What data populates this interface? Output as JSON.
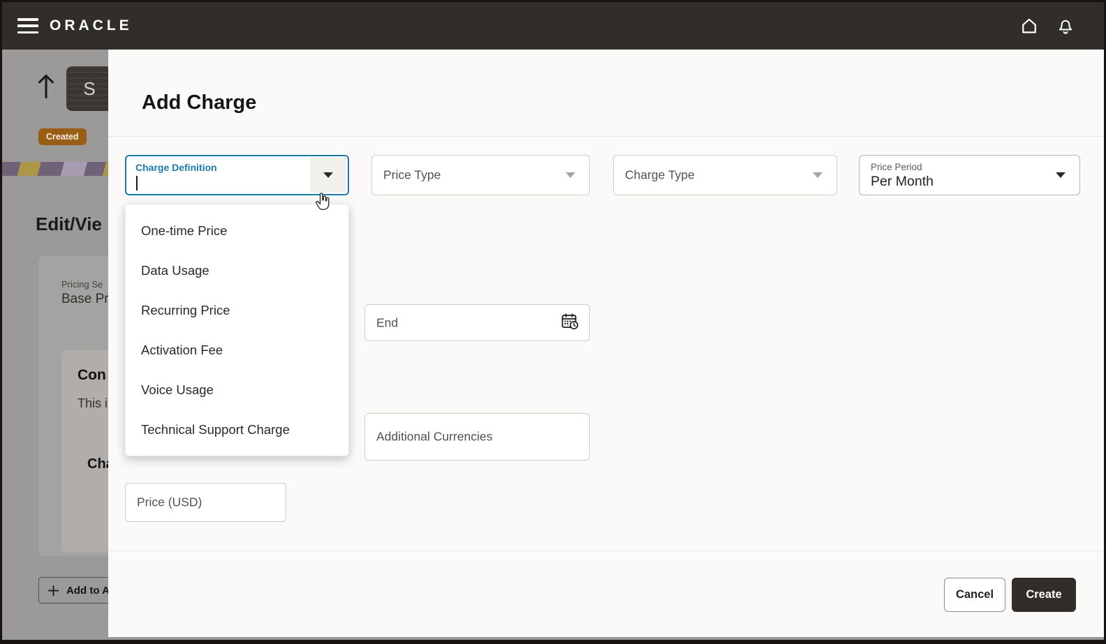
{
  "topbar": {
    "brand": "ORACLE"
  },
  "background_page": {
    "tile_letter": "S",
    "status_badge": "Created",
    "page_title_clipped": "Edit/Vie",
    "pricing_card": {
      "label_clipped": "Pricing Se",
      "value_clipped": "Base Pri",
      "section_heading_clipped": "Con",
      "body_text_clipped": "This i",
      "subheading_clipped": "Cha"
    },
    "add_button_clipped": "Add to A"
  },
  "dialog": {
    "title": "Add Charge",
    "fields": {
      "charge_definition": {
        "label": "Charge Definition",
        "value": ""
      },
      "price_type": {
        "label": "Price Type"
      },
      "charge_type": {
        "label": "Charge Type"
      },
      "price_period": {
        "label": "Price Period",
        "value": "Per Month"
      },
      "end": {
        "label": "End"
      },
      "additional_currencies": {
        "label": "Additional Currencies"
      },
      "price": {
        "label": "Price (USD)"
      }
    },
    "dropdown_options": [
      "One-time Price",
      "Data Usage",
      "Recurring Price",
      "Activation Fee",
      "Voice Usage",
      "Technical Support Charge"
    ],
    "buttons": {
      "cancel": "Cancel",
      "create": "Create"
    }
  },
  "colors": {
    "topbar_bg": "#312D2A",
    "accent_focus": "#1A7BA8",
    "badge_bg": "#9A5D15",
    "dialog_bg": "#FBFAF8",
    "create_button_bg": "#312D2A"
  }
}
